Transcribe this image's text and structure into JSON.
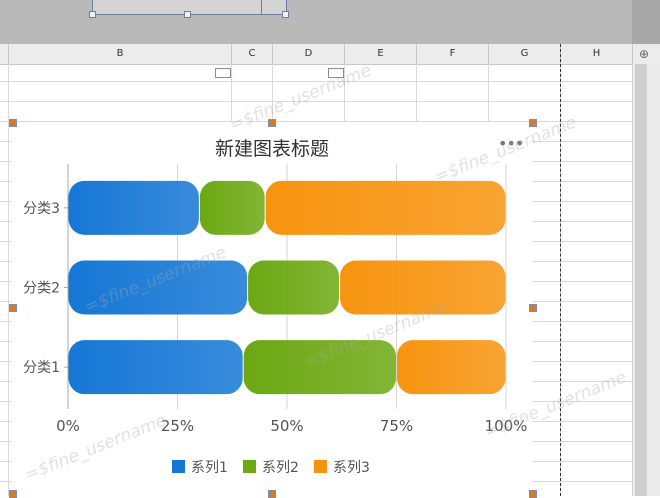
{
  "spreadsheet": {
    "columns": [
      "B",
      "C",
      "D",
      "E",
      "F",
      "G",
      "H"
    ]
  },
  "watermark_text": "=$fine_username",
  "chart_data": {
    "type": "bar",
    "orientation": "horizontal",
    "stacked": "percent",
    "title": "新建图表标题",
    "categories": [
      "分类1",
      "分类2",
      "分类3"
    ],
    "series": [
      {
        "name": "系列1",
        "values": [
          40,
          41,
          30
        ],
        "color": "#1577d5"
      },
      {
        "name": "系列2",
        "values": [
          35,
          21,
          15
        ],
        "color": "#6ca812"
      },
      {
        "name": "系列3",
        "values": [
          25,
          38,
          55
        ],
        "color": "#f7940f"
      }
    ],
    "xlim": [
      0,
      100
    ],
    "xticks": [
      "0%",
      "25%",
      "50%",
      "75%",
      "100%"
    ],
    "grid": true,
    "legend": "bottom"
  },
  "chart_menu": {
    "icon": "more-icon",
    "glyph": "•••"
  }
}
